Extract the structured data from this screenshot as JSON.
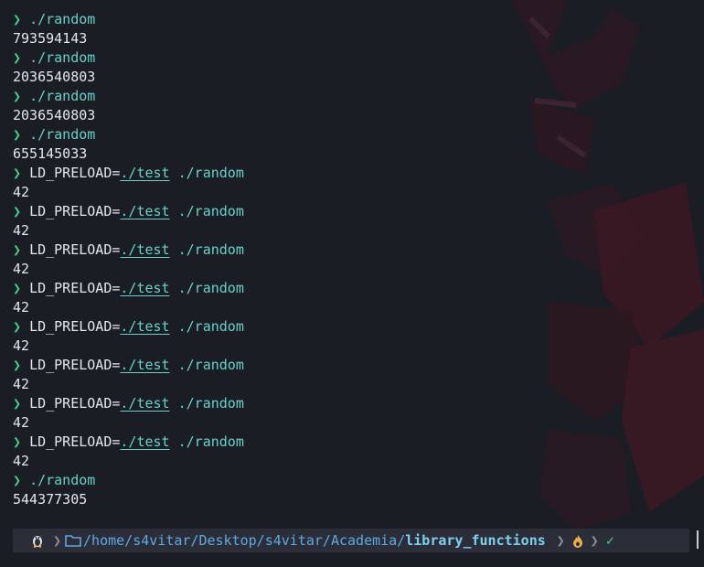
{
  "colors": {
    "background": "#1b1d25",
    "prompt_chevron": "#3fd08a",
    "command": "#6ad0c8",
    "path": "#5fa9e0",
    "ok": "#3fd08a",
    "warn": "#e8b04a"
  },
  "terminal": {
    "history": [
      {
        "kind": "cmd",
        "env": "",
        "envarg": "",
        "text": "./random"
      },
      {
        "kind": "out",
        "text": "793594143"
      },
      {
        "kind": "cmd",
        "env": "",
        "envarg": "",
        "text": "./random"
      },
      {
        "kind": "out",
        "text": "2036540803"
      },
      {
        "kind": "cmd",
        "env": "",
        "envarg": "",
        "text": "./random"
      },
      {
        "kind": "out",
        "text": "2036540803"
      },
      {
        "kind": "cmd",
        "env": "",
        "envarg": "",
        "text": "./random"
      },
      {
        "kind": "out",
        "text": "655145033"
      },
      {
        "kind": "cmd",
        "env": "LD_PRELOAD=",
        "envarg": "./test",
        "text": "./random"
      },
      {
        "kind": "out",
        "text": "42"
      },
      {
        "kind": "cmd",
        "env": "LD_PRELOAD=",
        "envarg": "./test",
        "text": "./random"
      },
      {
        "kind": "out",
        "text": "42"
      },
      {
        "kind": "cmd",
        "env": "LD_PRELOAD=",
        "envarg": "./test",
        "text": "./random"
      },
      {
        "kind": "out",
        "text": "42"
      },
      {
        "kind": "cmd",
        "env": "LD_PRELOAD=",
        "envarg": "./test",
        "text": "./random"
      },
      {
        "kind": "out",
        "text": "42"
      },
      {
        "kind": "cmd",
        "env": "LD_PRELOAD=",
        "envarg": "./test",
        "text": "./random"
      },
      {
        "kind": "out",
        "text": "42"
      },
      {
        "kind": "cmd",
        "env": "LD_PRELOAD=",
        "envarg": "./test",
        "text": "./random"
      },
      {
        "kind": "out",
        "text": "42"
      },
      {
        "kind": "cmd",
        "env": "LD_PRELOAD=",
        "envarg": "./test",
        "text": "./random"
      },
      {
        "kind": "out",
        "text": "42"
      },
      {
        "kind": "cmd",
        "env": "LD_PRELOAD=",
        "envarg": "./test",
        "text": "./random"
      },
      {
        "kind": "out",
        "text": "42"
      },
      {
        "kind": "cmd",
        "env": "",
        "envarg": "",
        "text": "./random"
      },
      {
        "kind": "out",
        "text": "544377305"
      }
    ],
    "prompt_symbol": "❯"
  },
  "promptbar": {
    "os_icon": "linux-penguin-icon",
    "folder_icon": "folder-icon",
    "path_prefix": "/home/s4vitar/Desktop/s4vitar/Academia/",
    "path_current": "library_functions",
    "separator": "❯",
    "git_icon": "flame-icon",
    "status_icon": "check-icon",
    "status_text": "✓"
  }
}
